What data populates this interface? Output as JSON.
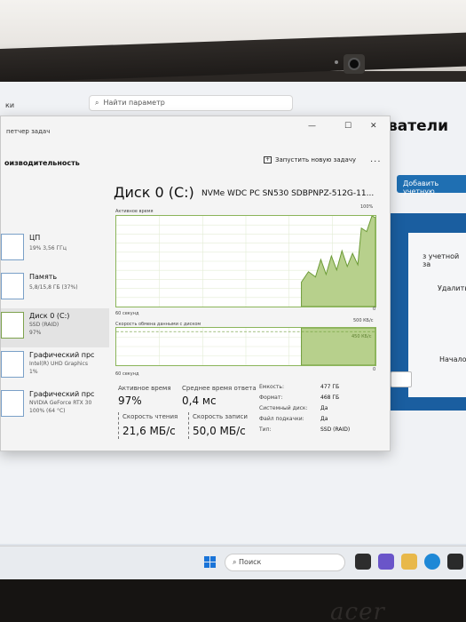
{
  "settings": {
    "back_text": "ки",
    "search_placeholder": "Найти параметр",
    "heading": "ватели",
    "add_button": "Добавить учетную",
    "account_text": "з учетной за",
    "remove_text": "Удалить",
    "start_text": "Начало"
  },
  "taskmanager": {
    "title": "петчер задач",
    "section_heading": "оизводительность",
    "run_task_label": "Запустить новую задачу",
    "more_label": "...",
    "window_buttons": [
      "—",
      "☐",
      "✕"
    ],
    "sidebar": [
      {
        "name": "ЦП",
        "sub1": "19%  3,56 ГГц",
        "sub2": ""
      },
      {
        "name": "Память",
        "sub1": "5,8/15,8 ГБ (37%)",
        "sub2": ""
      },
      {
        "name": "Диск 0 (C:)",
        "sub1": "SSD (RAID)",
        "sub2": "97%"
      },
      {
        "name": "Графический прс",
        "sub1": "Intel(R) UHD Graphics",
        "sub2": "1%"
      },
      {
        "name": "Графический прс",
        "sub1": "NVIDIA GeForce RTX 30",
        "sub2": "100% (64 °C)"
      }
    ],
    "main": {
      "title": "Диск 0 (C:)",
      "model": "NVMe WDC PC SN530 SDBPNPZ-512G-11...",
      "active_time_label": "Активное время",
      "active_time_max": "100%",
      "graph1_bottom_left": "60 секунд",
      "graph1_bottom_right": "0",
      "transfer_label": "Скорость обмена данными с диском",
      "transfer_max": "500 КБ/с",
      "transfer_marker": "450 КБ/с",
      "graph2_bottom_left": "60 секунд",
      "graph2_bottom_right": "0",
      "stats": {
        "active_time_title": "Активное время",
        "active_time_value": "97%",
        "avg_response_title": "Среднее время ответа",
        "avg_response_value": "0,4 мс",
        "read_speed_title": "Скорость чтения",
        "read_speed_value": "21,6 МБ/с",
        "write_speed_title": "Скорость записи",
        "write_speed_value": "50,0 МБ/с"
      },
      "properties": [
        {
          "key": "Емкость:",
          "value": "477 ГБ"
        },
        {
          "key": "Формат:",
          "value": "468 ГБ"
        },
        {
          "key": "Системный диск:",
          "value": "Да"
        },
        {
          "key": "Файл подкачки:",
          "value": "Да"
        },
        {
          "key": "Тип:",
          "value": "SSD (RAID)"
        }
      ]
    }
  },
  "taskbar": {
    "search_placeholder": "Поиск"
  },
  "laptop": {
    "brand": "acer"
  },
  "colors": {
    "graph_fill": "#b7d08c",
    "graph_line": "#6b9a35",
    "accent": "#1f6fb2"
  }
}
